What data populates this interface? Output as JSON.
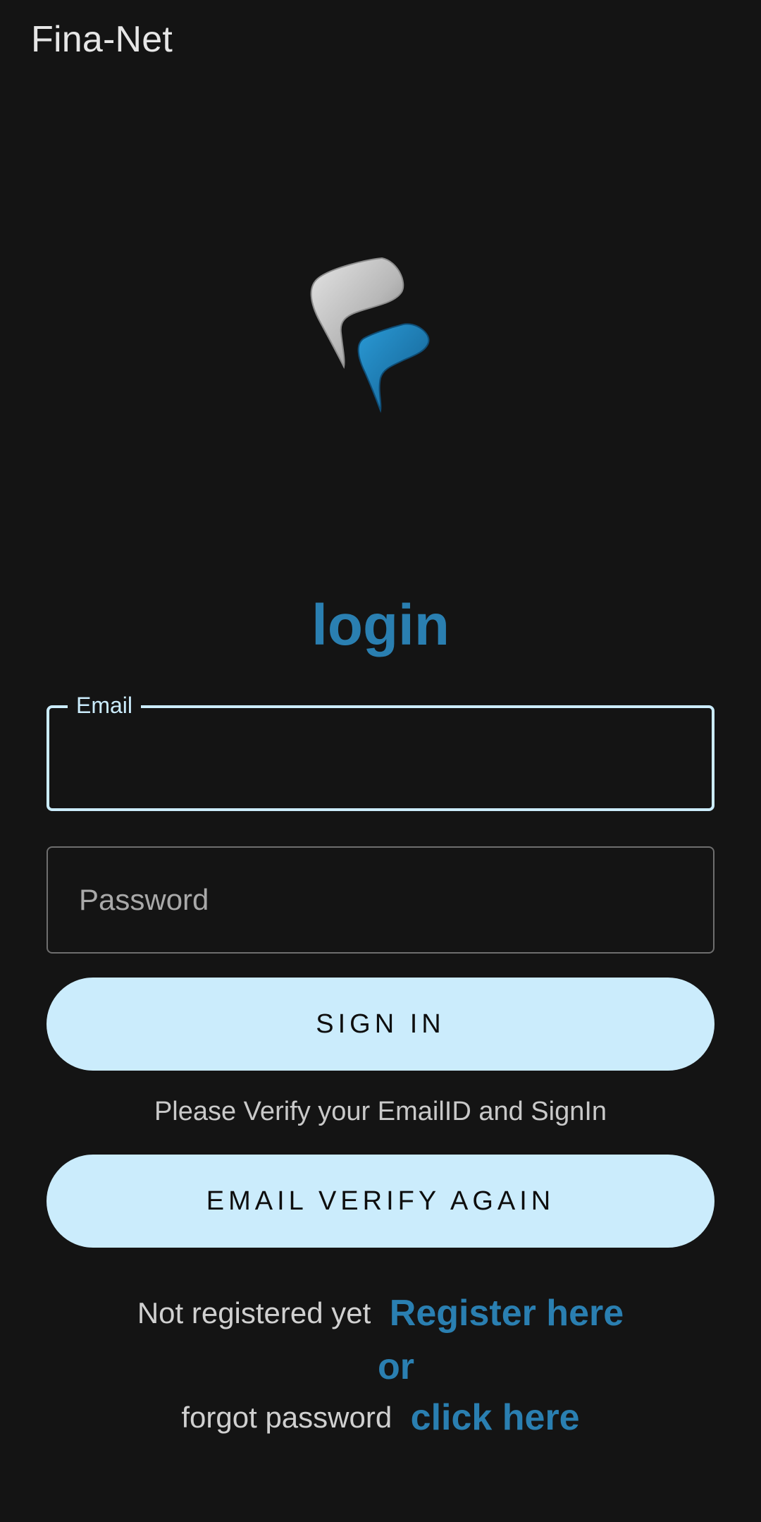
{
  "app": {
    "title": "Fina-Net"
  },
  "logo": {
    "icon": "fina-net-logo",
    "colors": {
      "silver": "#c9c9c9",
      "blue": "#1f86c0"
    }
  },
  "login": {
    "heading": "login",
    "email_label": "Email",
    "email_value": "",
    "password_placeholder": "Password",
    "password_value": "",
    "signin_label": "SIGN IN",
    "verify_message": "Please Verify your EmailID and SignIn",
    "verify_again_label": "EMAIL VERIFY AGAIN"
  },
  "footer": {
    "register_prompt": "Not registered yet",
    "register_link": "Register here",
    "or_text": "or",
    "forgot_prompt": "forgot password",
    "forgot_link": "click here"
  },
  "colors": {
    "background": "#141414",
    "accent": "#2a7fb1",
    "button_bg": "#cbecfc",
    "focus_border": "#cbecfc"
  }
}
